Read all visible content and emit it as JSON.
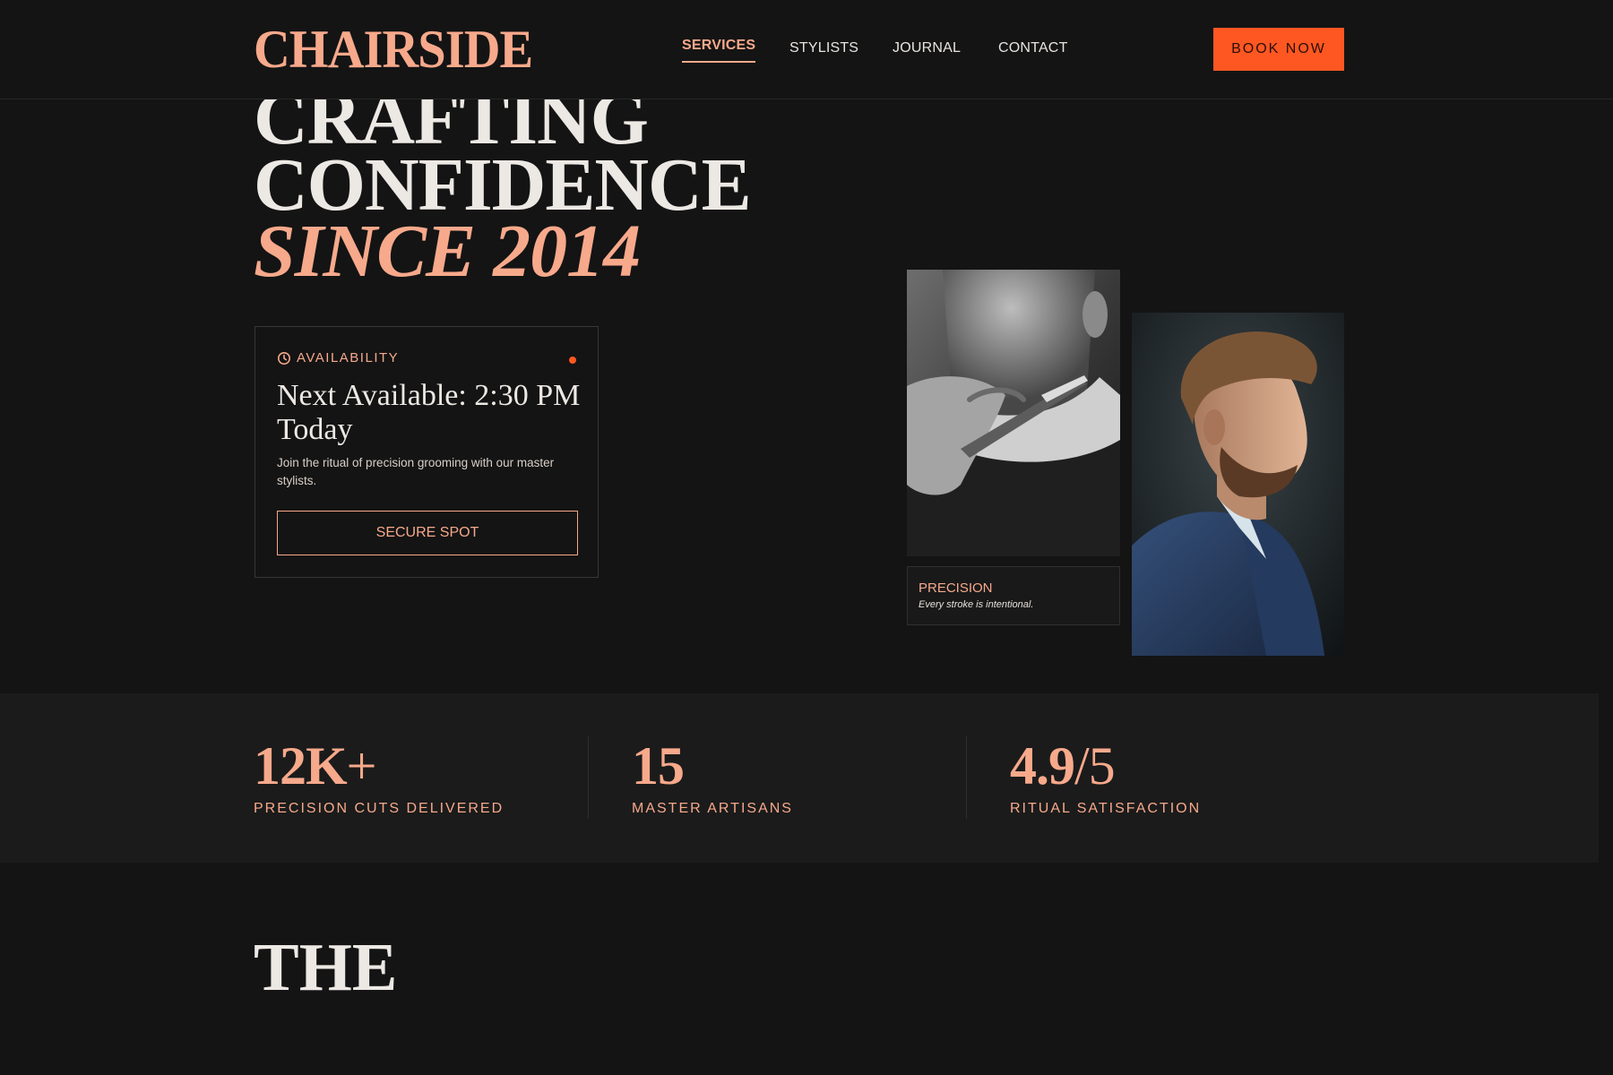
{
  "brand": {
    "logo": "CHAIRSIDE"
  },
  "nav": {
    "items": [
      {
        "label": "SERVICES",
        "active": true
      },
      {
        "label": "STYLISTS",
        "active": false
      },
      {
        "label": "JOURNAL",
        "active": false
      },
      {
        "label": "CONTACT",
        "active": false
      }
    ],
    "cta": "BOOK NOW"
  },
  "hero": {
    "line1": "CRAFTING",
    "line2": "CONFIDENCE",
    "line3": "SINCE 2014"
  },
  "availability": {
    "label": "AVAILABILITY",
    "title": "Next Available: 2:30 PM Today",
    "description": "Join the ritual of precision grooming with our master stylists.",
    "button": "SECURE SPOT",
    "status_color": "#ff5722"
  },
  "gallery": {
    "caption_title": "PRECISION",
    "caption_sub": "Every stroke is intentional."
  },
  "stats": [
    {
      "value": "12K",
      "suffix": "+",
      "label": "PRECISION CUTS DELIVERED"
    },
    {
      "value": "15",
      "suffix": "",
      "label": "MASTER ARTISANS"
    },
    {
      "value": "4.9",
      "suffix": "/5",
      "label": "RITUAL SATISFACTION"
    }
  ],
  "next_section": {
    "title": "THE"
  },
  "colors": {
    "background": "#141414",
    "accent": "#f7a98b",
    "cta": "#ff5722",
    "text": "#ece8e4"
  }
}
